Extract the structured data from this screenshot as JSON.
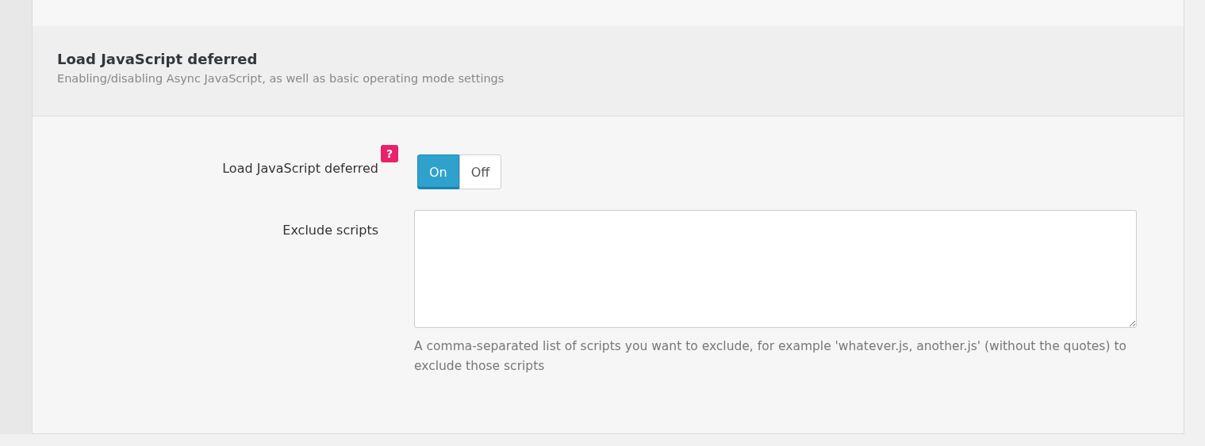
{
  "section": {
    "title": "Load JavaScript deferred",
    "description": "Enabling/disabling Async JavaScript, as well as basic operating mode settings"
  },
  "fields": [
    {
      "kind": "toggle",
      "label": "Load JavaScript deferred",
      "help": "?",
      "options": [
        {
          "label": "On",
          "selected": true
        },
        {
          "label": "Off",
          "selected": false
        }
      ]
    },
    {
      "kind": "textarea",
      "label": "Exclude scripts",
      "description": "A comma-separated list of scripts you want to exclude, for example 'whatever.js, another.js' (without the quotes) to exclude those scripts"
    }
  ]
}
